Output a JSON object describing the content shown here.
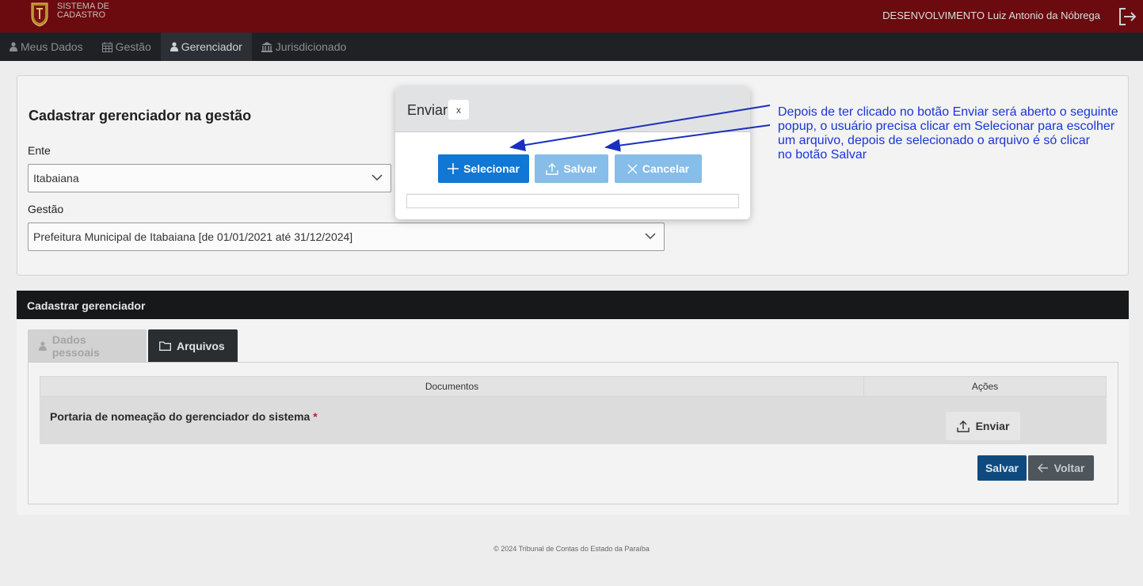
{
  "header": {
    "brand_line1": "SISTEMA DE",
    "brand_line2": "CADASTRO",
    "user": "DESENVOLVIMENTO Luiz Antonio da Nóbrega",
    "logo_icon": "tce-crest-logo",
    "logout_icon": "logout-icon"
  },
  "nav": {
    "items": [
      {
        "label": "Meus Dados",
        "icon": "user-icon"
      },
      {
        "label": "Gestão",
        "icon": "calendar-icon"
      },
      {
        "label": "Gerenciador",
        "icon": "user-icon",
        "active": true
      },
      {
        "label": "Jurisdicionado",
        "icon": "institution-icon"
      }
    ]
  },
  "form": {
    "title": "Cadastrar gerenciador na gestão",
    "ente_label": "Ente",
    "ente_value": "Itabaiana",
    "gestao_label": "Gestão",
    "gestao_value": "Prefeitura Municipal de Itabaiana [de 01/01/2021 até 31/12/2024]"
  },
  "cadastro": {
    "header": "Cadastrar gerenciador",
    "tabs": [
      {
        "label": "Dados pessoais",
        "icon": "user-icon"
      },
      {
        "label": "Arquivos",
        "icon": "folder-icon",
        "active": true
      }
    ],
    "table": {
      "columns": [
        "Documentos",
        "Ações"
      ],
      "rows": [
        {
          "document": "Portaria de nomeação do gerenciador do sistema",
          "required_mark": "*",
          "action": "Enviar"
        }
      ]
    },
    "save_label": "Salvar",
    "back_label": "Voltar"
  },
  "footer": "© 2024 Tribunal de Contas do Estado da Paraíba",
  "modal": {
    "title": "Enviar",
    "close_label": "x",
    "select_label": "Selecionar",
    "save_label": "Salvar",
    "cancel_label": "Cancelar"
  },
  "annotation": {
    "lines": [
      "Depois de ter clicado no botão Enviar será aberto o seguinte",
      "popup, o usuário precisa clicar em Selecionar para escolher",
      "um arquivo, depois de selecionado o arquivo é só clicar",
      "no botão Salvar"
    ]
  },
  "colors": {
    "topbar": "#6b0a0f",
    "primary": "#1077d4",
    "annotation": "#1a35d6"
  }
}
